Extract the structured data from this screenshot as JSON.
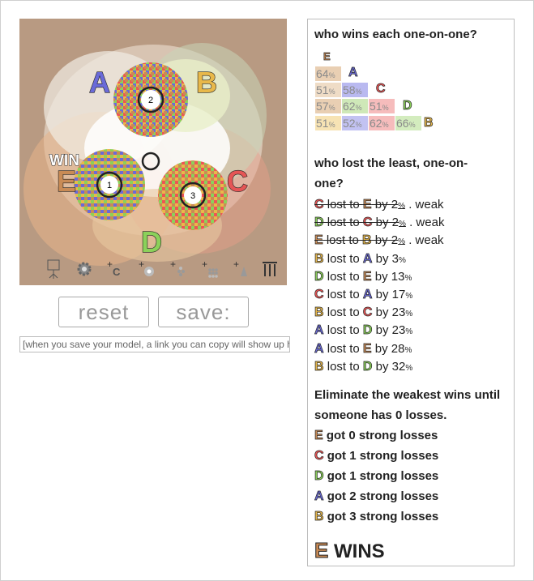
{
  "sim": {
    "candidates": [
      {
        "letter": "A",
        "color": "#6a6ad8"
      },
      {
        "letter": "B",
        "color": "#e8b84a"
      },
      {
        "letter": "C",
        "color": "#e55555"
      },
      {
        "letter": "D",
        "color": "#8bd15a"
      },
      {
        "letter": "E",
        "color": "#c98b55"
      }
    ],
    "voter_groups": [
      "1",
      "2",
      "3"
    ],
    "win_label": "WIN",
    "tools": [
      "place-icon",
      "gear-icon",
      "add-candidate-c-icon",
      "add-voter-icon",
      "add-voter-group-icon",
      "add-dense-group-icon",
      "add-spread-icon",
      "bars-icon"
    ]
  },
  "buttons": {
    "reset": "reset",
    "save": "save:"
  },
  "link_placeholder": "[when you save your model, a link you can copy will show up here]",
  "panel": {
    "pairwise_heading": "who wins each one-on-one?",
    "matrix": {
      "col_letters": [
        "E",
        "A",
        "C",
        "D",
        "B"
      ],
      "rows": [
        [
          {
            "v": "64",
            "u": "%"
          }
        ],
        [
          {
            "v": "51",
            "u": "%"
          },
          {
            "v": "58",
            "u": "%"
          }
        ],
        [
          {
            "v": "57",
            "u": "%"
          },
          {
            "v": "62",
            "u": "%"
          },
          {
            "v": "51",
            "u": "%"
          }
        ],
        [
          {
            "v": "51",
            "u": "%"
          },
          {
            "v": "52",
            "u": "%"
          },
          {
            "v": "62",
            "u": "%"
          },
          {
            "v": "66",
            "u": "%"
          }
        ]
      ]
    },
    "lost_heading": "who lost the least, one-on-one?",
    "losses": [
      {
        "loser": "C",
        "text1": " lost to ",
        "winner": "E",
        "text2": " by 2",
        "unit": "%",
        "tail": " . weak",
        "weak": true
      },
      {
        "loser": "D",
        "text1": " lost to ",
        "winner": "C",
        "text2": " by 2",
        "unit": "%",
        "tail": " . weak",
        "weak": true
      },
      {
        "loser": "E",
        "text1": " lost to ",
        "winner": "B",
        "text2": " by 2",
        "unit": "%",
        "tail": " . weak",
        "weak": true
      },
      {
        "loser": "B",
        "text1": " lost to ",
        "winner": "A",
        "text2": " by 3",
        "unit": "%",
        "tail": "",
        "weak": false
      },
      {
        "loser": "D",
        "text1": " lost to ",
        "winner": "E",
        "text2": " by 13",
        "unit": "%",
        "tail": "",
        "weak": false
      },
      {
        "loser": "C",
        "text1": " lost to ",
        "winner": "A",
        "text2": " by 17",
        "unit": "%",
        "tail": "",
        "weak": false
      },
      {
        "loser": "B",
        "text1": " lost to ",
        "winner": "C",
        "text2": " by 23",
        "unit": "%",
        "tail": "",
        "weak": false
      },
      {
        "loser": "A",
        "text1": " lost to ",
        "winner": "D",
        "text2": " by 23",
        "unit": "%",
        "tail": "",
        "weak": false
      },
      {
        "loser": "A",
        "text1": " lost to ",
        "winner": "E",
        "text2": " by 28",
        "unit": "%",
        "tail": "",
        "weak": false
      },
      {
        "loser": "B",
        "text1": " lost to ",
        "winner": "D",
        "text2": " by 32",
        "unit": "%",
        "tail": "",
        "weak": false
      }
    ],
    "eliminate_heading": "Eliminate the weakest wins until someone has 0 losses.",
    "strong_losses": [
      {
        "letter": "E",
        "text": " got 0 strong losses"
      },
      {
        "letter": "C",
        "text": " got 1 strong losses"
      },
      {
        "letter": "D",
        "text": " got 1 strong losses"
      },
      {
        "letter": "A",
        "text": " got 2 strong losses"
      },
      {
        "letter": "B",
        "text": " got 3 strong losses"
      }
    ],
    "winner": {
      "letter": "E",
      "text": " WINS"
    }
  }
}
